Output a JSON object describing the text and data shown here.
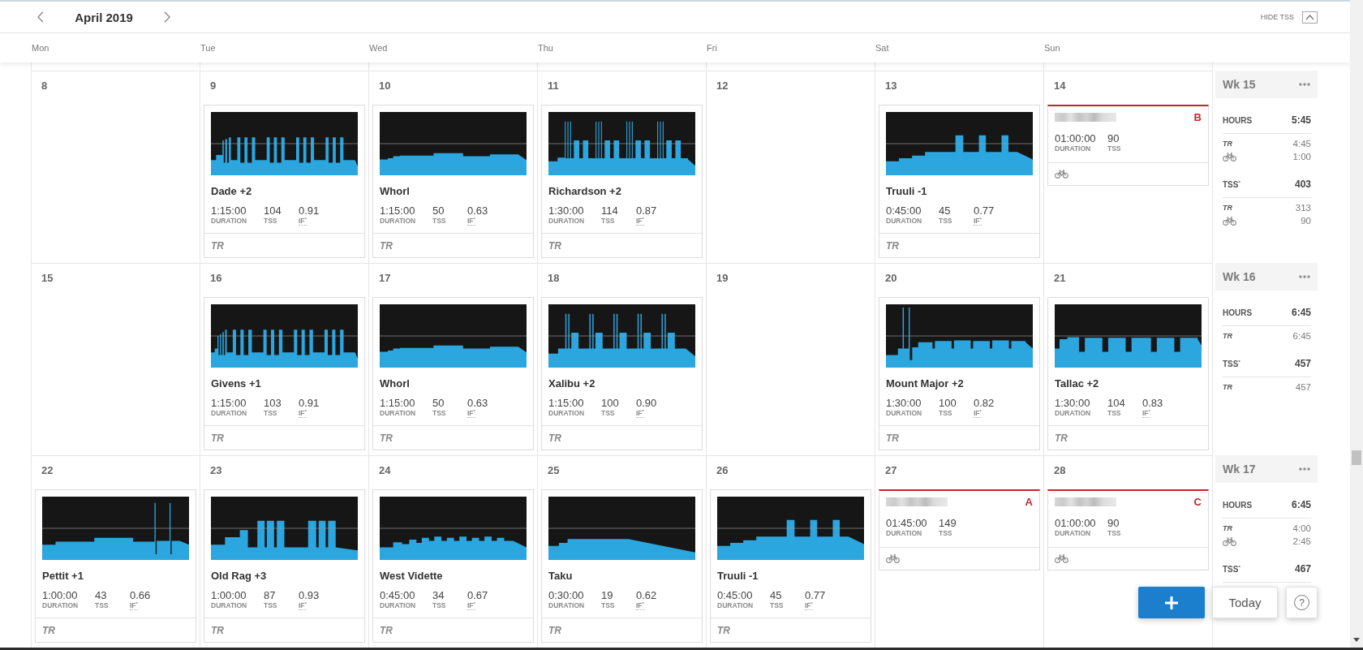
{
  "header": {
    "month": "April 2019",
    "hide_tss": "HIDE TSS"
  },
  "weekdays": [
    "Mon",
    "Tue",
    "Wed",
    "Thu",
    "Fri",
    "Sat",
    "Sun"
  ],
  "weeks": [
    {
      "days": [
        {
          "date": "8"
        },
        {
          "date": "9",
          "items": [
            {
              "kind": "workout",
              "name": "Dade +2",
              "stats": [
                {
                  "kind": "duration",
                  "value": "1:15:00",
                  "label": "DURATION"
                },
                {
                  "kind": "tss",
                  "value": "104",
                  "label": "TSS"
                },
                {
                  "kind": "if",
                  "value": "0.91",
                  "label": "IF$^{*}$"
                }
              ],
              "source": "TR"
            }
          ]
        },
        {
          "date": "10",
          "items": [
            {
              "kind": "workout",
              "name": "Whorl",
              "stats": [
                {
                  "kind": "duration",
                  "value": "1:15:00",
                  "label": "DURATION"
                },
                {
                  "kind": "tss",
                  "value": "50",
                  "label": "TSS"
                },
                {
                  "kind": "if",
                  "value": "0.63",
                  "label": "IF$^{*}$"
                }
              ],
              "source": "TR"
            }
          ]
        },
        {
          "date": "11",
          "items": [
            {
              "kind": "workout",
              "name": "Richardson +2",
              "stats": [
                {
                  "kind": "duration",
                  "value": "1:30:00",
                  "label": "DURATION"
                },
                {
                  "kind": "tss",
                  "value": "114",
                  "label": "TSS"
                },
                {
                  "kind": "if",
                  "value": "0.87",
                  "label": "IF$^{*}$"
                }
              ],
              "source": "TR"
            }
          ]
        },
        {
          "date": "12"
        },
        {
          "date": "13",
          "items": [
            {
              "kind": "workout",
              "name": "Truuli -1",
              "stats": [
                {
                  "kind": "duration",
                  "value": "0:45:00",
                  "label": "DURATION"
                },
                {
                  "kind": "tss",
                  "value": "45",
                  "label": "TSS"
                },
                {
                  "kind": "if",
                  "value": "0.77",
                  "label": "IF$^{*}$"
                }
              ],
              "source": "TR"
            }
          ]
        },
        {
          "date": "14",
          "items": [
            {
              "kind": "event",
              "priority": "B",
              "stats": [
                {
                  "kind": "duration",
                  "value": "01:00:00",
                  "label": "DURATION"
                },
                {
                  "kind": "tss",
                  "value": "90",
                  "label": "TSS"
                }
              ]
            }
          ]
        }
      ],
      "summary": {
        "title": "Wk 15",
        "sections": [
          {
            "label": "HOURS",
            "value": "5:45",
            "rows": [
              {
                "kind": "tr",
                "label": "TR",
                "value": "4:45"
              },
              {
                "kind": "bike",
                "value": "1:00"
              }
            ]
          },
          {
            "label": "TSS$^{*}$",
            "value": "403",
            "rows": [
              {
                "kind": "tr",
                "label": "TR",
                "value": "313"
              },
              {
                "kind": "bike",
                "value": "90"
              }
            ]
          }
        ]
      }
    },
    {
      "days": [
        {
          "date": "15"
        },
        {
          "date": "16",
          "items": [
            {
              "kind": "workout",
              "name": "Givens +1",
              "stats": [
                {
                  "kind": "duration",
                  "value": "1:15:00",
                  "label": "DURATION"
                },
                {
                  "kind": "tss",
                  "value": "103",
                  "label": "TSS"
                },
                {
                  "kind": "if",
                  "value": "0.91",
                  "label": "IF$^{*}$"
                }
              ],
              "source": "TR"
            }
          ]
        },
        {
          "date": "17",
          "items": [
            {
              "kind": "workout",
              "name": "Whorl",
              "stats": [
                {
                  "kind": "duration",
                  "value": "1:15:00",
                  "label": "DURATION"
                },
                {
                  "kind": "tss",
                  "value": "50",
                  "label": "TSS"
                },
                {
                  "kind": "if",
                  "value": "0.63",
                  "label": "IF$^{*}$"
                }
              ],
              "source": "TR"
            }
          ]
        },
        {
          "date": "18",
          "items": [
            {
              "kind": "workout",
              "name": "Xalibu +2",
              "stats": [
                {
                  "kind": "duration",
                  "value": "1:15:00",
                  "label": "DURATION"
                },
                {
                  "kind": "tss",
                  "value": "100",
                  "label": "TSS"
                },
                {
                  "kind": "if",
                  "value": "0.90",
                  "label": "IF$^{*}$"
                }
              ],
              "source": "TR"
            }
          ]
        },
        {
          "date": "19"
        },
        {
          "date": "20",
          "items": [
            {
              "kind": "workout",
              "name": "Mount Major +2",
              "stats": [
                {
                  "kind": "duration",
                  "value": "1:30:00",
                  "label": "DURATION"
                },
                {
                  "kind": "tss",
                  "value": "100",
                  "label": "TSS"
                },
                {
                  "kind": "if",
                  "value": "0.82",
                  "label": "IF$^{*}$"
                }
              ],
              "source": "TR"
            }
          ]
        },
        {
          "date": "21",
          "items": [
            {
              "kind": "workout",
              "name": "Tallac +2",
              "stats": [
                {
                  "kind": "duration",
                  "value": "1:30:00",
                  "label": "DURATION"
                },
                {
                  "kind": "tss",
                  "value": "104",
                  "label": "TSS"
                },
                {
                  "kind": "if",
                  "value": "0.83",
                  "label": "IF$^{*}$"
                }
              ],
              "source": "TR"
            }
          ]
        }
      ],
      "summary": {
        "title": "Wk 16",
        "sections": [
          {
            "label": "HOURS",
            "value": "6:45",
            "rows": [
              {
                "kind": "tr",
                "label": "TR",
                "value": "6:45"
              }
            ]
          },
          {
            "label": "TSS$^{*}$",
            "value": "457",
            "rows": [
              {
                "kind": "tr",
                "label": "TR",
                "value": "457"
              }
            ]
          }
        ]
      }
    },
    {
      "days": [
        {
          "date": "22",
          "items": [
            {
              "kind": "workout",
              "name": "Pettit +1",
              "stats": [
                {
                  "kind": "duration",
                  "value": "1:00:00",
                  "label": "DURATION"
                },
                {
                  "kind": "tss",
                  "value": "43",
                  "label": "TSS"
                },
                {
                  "kind": "if",
                  "value": "0.66",
                  "label": "IF$^{*}$"
                }
              ],
              "source": "TR"
            }
          ]
        },
        {
          "date": "23",
          "items": [
            {
              "kind": "workout",
              "name": "Old Rag +3",
              "stats": [
                {
                  "kind": "duration",
                  "value": "1:00:00",
                  "label": "DURATION"
                },
                {
                  "kind": "tss",
                  "value": "87",
                  "label": "TSS"
                },
                {
                  "kind": "if",
                  "value": "0.93",
                  "label": "IF$^{*}$"
                }
              ],
              "source": "TR"
            }
          ]
        },
        {
          "date": "24",
          "items": [
            {
              "kind": "workout",
              "name": "West Vidette",
              "stats": [
                {
                  "kind": "duration",
                  "value": "0:45:00",
                  "label": "DURATION"
                },
                {
                  "kind": "tss",
                  "value": "34",
                  "label": "TSS"
                },
                {
                  "kind": "if",
                  "value": "0.67",
                  "label": "IF$^{*}$"
                }
              ],
              "source": "TR"
            }
          ]
        },
        {
          "date": "25",
          "items": [
            {
              "kind": "workout",
              "name": "Taku",
              "stats": [
                {
                  "kind": "duration",
                  "value": "0:30:00",
                  "label": "DURATION"
                },
                {
                  "kind": "tss",
                  "value": "19",
                  "label": "TSS"
                },
                {
                  "kind": "if",
                  "value": "0.62",
                  "label": "IF$^{*}$"
                }
              ],
              "source": "TR"
            }
          ]
        },
        {
          "date": "26",
          "items": [
            {
              "kind": "workout",
              "name": "Truuli -1",
              "stats": [
                {
                  "kind": "duration",
                  "value": "0:45:00",
                  "label": "DURATION"
                },
                {
                  "kind": "tss",
                  "value": "45",
                  "label": "TSS"
                },
                {
                  "kind": "if",
                  "value": "0.77",
                  "label": "IF$^{*}$"
                }
              ],
              "source": "TR"
            }
          ]
        },
        {
          "date": "27",
          "items": [
            {
              "kind": "event",
              "priority": "A",
              "stats": [
                {
                  "kind": "duration",
                  "value": "01:45:00",
                  "label": "DURATION"
                },
                {
                  "kind": "tss",
                  "value": "149",
                  "label": "TSS"
                }
              ]
            }
          ]
        },
        {
          "date": "28",
          "items": [
            {
              "kind": "event",
              "priority": "C",
              "stats": [
                {
                  "kind": "duration",
                  "value": "01:00:00",
                  "label": "DURATION"
                },
                {
                  "kind": "tss",
                  "value": "90",
                  "label": "TSS"
                }
              ]
            }
          ]
        }
      ],
      "summary": {
        "title": "Wk 17",
        "sections": [
          {
            "label": "HOURS",
            "value": "6:45",
            "rows": [
              {
                "kind": "tr",
                "label": "TR",
                "value": "4:00"
              },
              {
                "kind": "bike",
                "value": "2:45"
              }
            ]
          },
          {
            "label": "TSS$^{*}$",
            "value": "467"
          }
        ]
      }
    }
  ],
  "actions": {
    "today": "Today",
    "help": "?"
  }
}
